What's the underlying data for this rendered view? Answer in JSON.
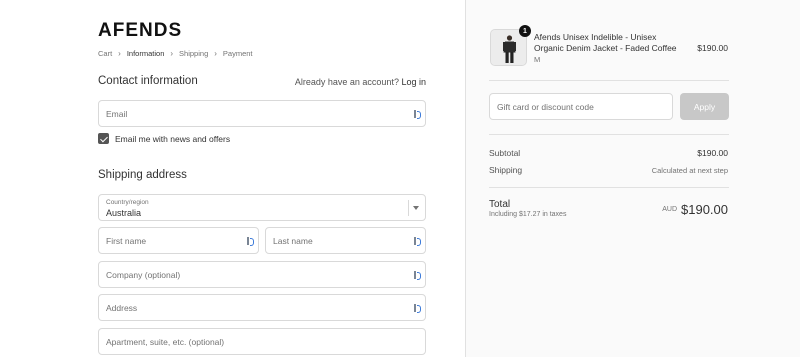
{
  "brand": {
    "logo": "AFENDS"
  },
  "breadcrumb": [
    "Cart",
    "Information",
    "Shipping",
    "Payment"
  ],
  "contact": {
    "title": "Contact information",
    "login_prompt": "Already have an account?",
    "login_link": "Log in",
    "email_placeholder": "Email",
    "newsletter_label": "Email me with news and offers",
    "newsletter_checked": true
  },
  "shipping": {
    "title": "Shipping address",
    "country_label": "Country/region",
    "country_value": "Australia",
    "first_name_placeholder": "First name",
    "last_name_placeholder": "Last name",
    "company_placeholder": "Company (optional)",
    "address_placeholder": "Address",
    "apartment_placeholder": "Apartment, suite, etc. (optional)"
  },
  "order": {
    "quantity_badge": "1",
    "product_name": "Afends Unisex Indelible - Unisex Organic Denim Jacket - Faded Coffee",
    "product_variant": "M",
    "product_price": "$190.00",
    "discount_placeholder": "Gift card or discount code",
    "apply_label": "Apply",
    "subtotal_label": "Subtotal",
    "subtotal_value": "$190.00",
    "shipping_label": "Shipping",
    "shipping_value": "Calculated at next step",
    "total_label": "Total",
    "taxes_note": "Including $17.27 in taxes",
    "currency": "AUD",
    "total_value": "$190.00"
  }
}
